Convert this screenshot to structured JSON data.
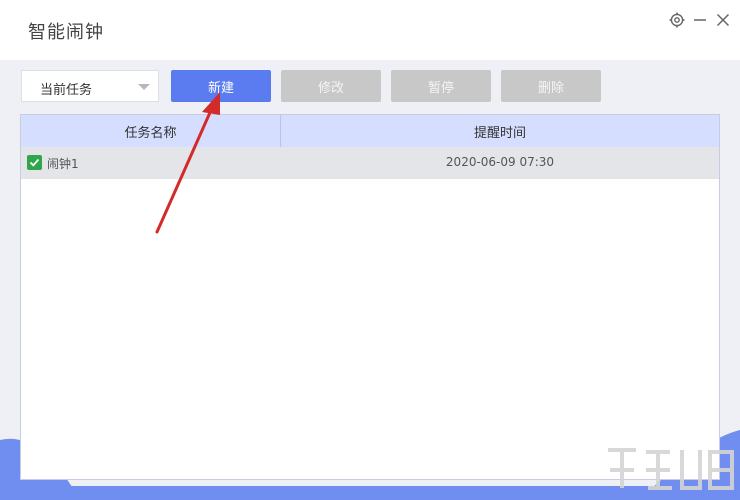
{
  "window": {
    "title": "智能闹钟",
    "controls": [
      "settings-icon",
      "minimize-icon",
      "close-icon"
    ]
  },
  "toolbar": {
    "filter_selected": "当前任务",
    "new_label": "新建",
    "edit_label": "修改",
    "pause_label": "暂停",
    "delete_label": "删除"
  },
  "table": {
    "columns": [
      "任务名称",
      "提醒时间"
    ],
    "rows": [
      {
        "name": "闹钟1",
        "time": "2020-06-09 07:30",
        "checked": true
      }
    ]
  },
  "colors": {
    "primary": "#5a7cf0",
    "disabled": "#c8c8c8",
    "header_bg": "#d6deff",
    "checkbox": "#2fa64b",
    "annotation_arrow": "#d32a2a"
  }
}
